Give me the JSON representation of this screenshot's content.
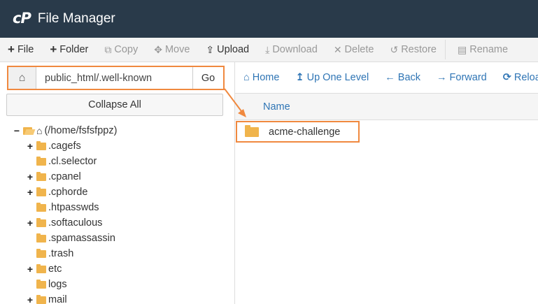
{
  "app": {
    "logo": "cP",
    "title": "File Manager"
  },
  "toolbar": [
    {
      "icon": "+",
      "label": "File",
      "enabled": true
    },
    {
      "icon": "+",
      "label": "Folder",
      "enabled": true
    },
    {
      "icon": "⧉",
      "label": "Copy",
      "enabled": false
    },
    {
      "icon": "✥",
      "label": "Move",
      "enabled": false
    },
    {
      "icon": "⇪",
      "label": "Upload",
      "enabled": true
    },
    {
      "icon": "⤓",
      "label": "Download",
      "enabled": false
    },
    {
      "icon": "✕",
      "label": "Delete",
      "enabled": false
    },
    {
      "icon": "↺",
      "label": "Restore",
      "enabled": false
    },
    {
      "icon": "▤",
      "label": "Rename",
      "enabled": false
    }
  ],
  "pathbar": {
    "path": "public_html/.well-known",
    "go_label": "Go"
  },
  "collapse_label": "Collapse All",
  "tree": {
    "root_label": "(/home/fsfsfppz)",
    "items": [
      {
        "label": ".cagefs",
        "expandable": true
      },
      {
        "label": ".cl.selector",
        "expandable": false
      },
      {
        "label": ".cpanel",
        "expandable": true
      },
      {
        "label": ".cphorde",
        "expandable": true
      },
      {
        "label": ".htpasswds",
        "expandable": false
      },
      {
        "label": ".softaculous",
        "expandable": true
      },
      {
        "label": ".spamassassin",
        "expandable": false
      },
      {
        "label": ".trash",
        "expandable": false
      },
      {
        "label": "etc",
        "expandable": true
      },
      {
        "label": "logs",
        "expandable": false
      },
      {
        "label": "mail",
        "expandable": true
      }
    ]
  },
  "nav": {
    "home": "Home",
    "up": "Up One Level",
    "back": "Back",
    "forward": "Forward",
    "reload": "Reload"
  },
  "list": {
    "column_name": "Name",
    "files": [
      {
        "name": "acme-challenge",
        "type": "folder"
      }
    ]
  },
  "colors": {
    "header": "#293a4a",
    "highlight": "#f0893f",
    "link": "#2f75b5",
    "folder": "#f0b44c"
  }
}
